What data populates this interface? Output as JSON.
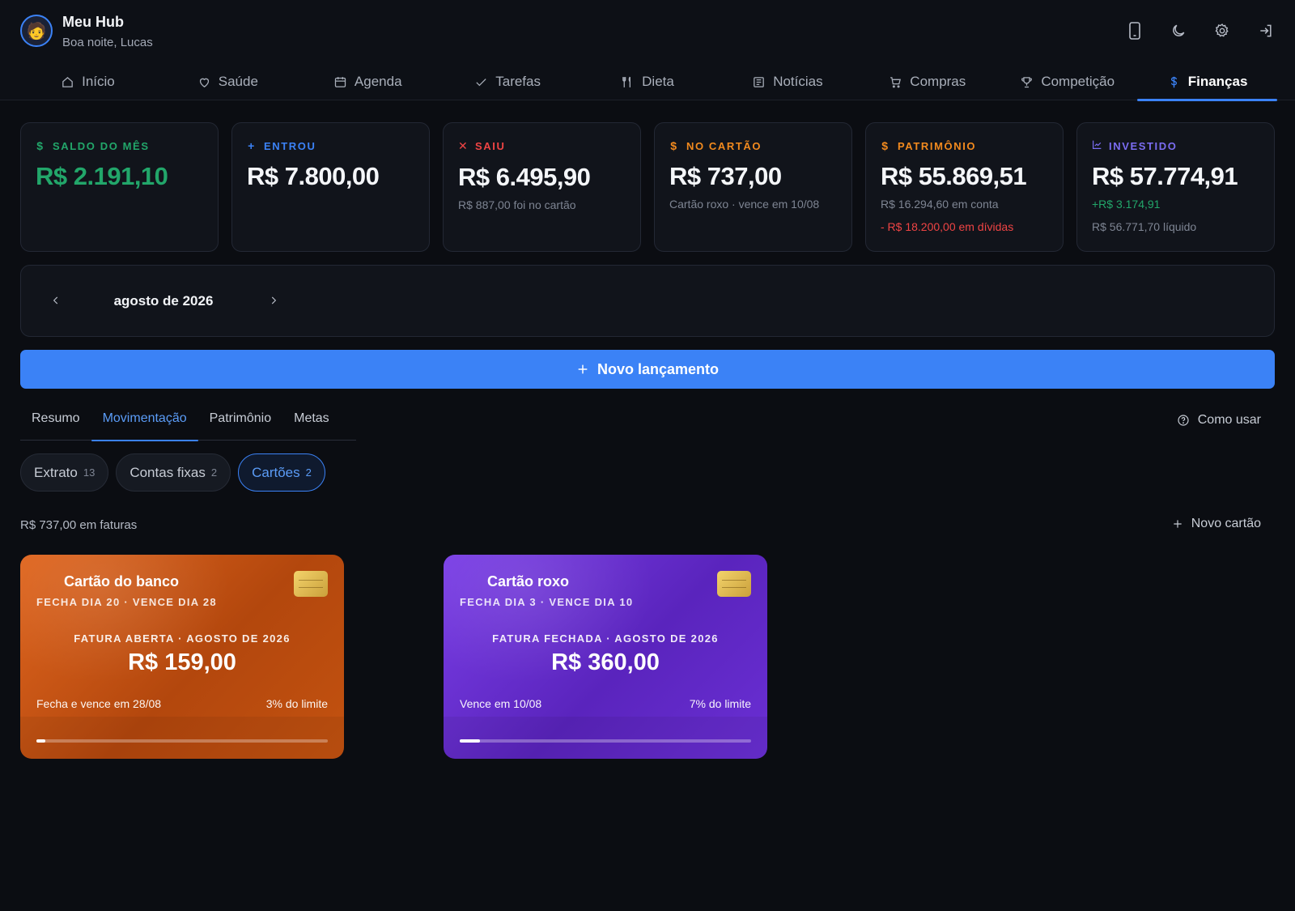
{
  "header": {
    "avatar_emoji": "🧑",
    "title": "Meu Hub",
    "greeting": "Boa noite, Lucas",
    "icons": [
      "phone-icon",
      "moon-icon",
      "gear-icon",
      "logout-icon"
    ]
  },
  "nav": [
    {
      "label": "Início",
      "icon": "home-icon"
    },
    {
      "label": "Saúde",
      "icon": "heart-icon"
    },
    {
      "label": "Agenda",
      "icon": "calendar-icon"
    },
    {
      "label": "Tarefas",
      "icon": "check-icon"
    },
    {
      "label": "Dieta",
      "icon": "utensils-icon"
    },
    {
      "label": "Notícias",
      "icon": "newspaper-icon"
    },
    {
      "label": "Compras",
      "icon": "cart-icon"
    },
    {
      "label": "Competição",
      "icon": "trophy-icon"
    },
    {
      "label": "Finanças",
      "icon": "dollar-icon",
      "active": true
    }
  ],
  "stats": {
    "saldo": {
      "label": "SALDO DO MÊS",
      "value": "R$ 2.191,10"
    },
    "entrou": {
      "label": "ENTROU",
      "value": "R$ 7.800,00"
    },
    "saiu": {
      "label": "SAIU",
      "value": "R$ 6.495,90",
      "sub": "R$ 887,00 foi no cartão"
    },
    "cartao": {
      "label": "NO CARTÃO",
      "value": "R$ 737,00",
      "sub": "Cartão roxo · vence em 10/08"
    },
    "patrimonio": {
      "label": "PATRIMÔNIO",
      "value": "R$ 55.869,51",
      "sub": "R$ 16.294,60 em conta",
      "sub2": "- R$ 18.200,00 em dívidas"
    },
    "investido": {
      "label": "INVESTIDO",
      "value": "R$ 57.774,91",
      "sub": "+R$ 3.174,91",
      "sub2": "R$ 56.771,70 líquido"
    }
  },
  "month": {
    "label": "agosto de 2026"
  },
  "new_entry_label": "Novo lançamento",
  "tabs": [
    {
      "label": "Resumo"
    },
    {
      "label": "Movimentação",
      "active": true
    },
    {
      "label": "Patrimônio"
    },
    {
      "label": "Metas"
    }
  ],
  "help_label": "Como usar",
  "chips": [
    {
      "label": "Extrato",
      "count": "13"
    },
    {
      "label": "Contas fixas",
      "count": "2"
    },
    {
      "label": "Cartões",
      "count": "2",
      "active": true
    }
  ],
  "faturas_total": "R$ 737,00 em faturas",
  "new_card_label": "Novo cartão",
  "cards": [
    {
      "name": "Cartão do banco",
      "dates": "FECHA DIA 20 · VENCE DIA 28",
      "status": "FATURA ABERTA · AGOSTO DE 2026",
      "amount": "R$ 159,00",
      "due": "Fecha e vence em 28/08",
      "limit": "3% do limite",
      "limit_fraction": 0.03,
      "color": "#d45a16"
    },
    {
      "name": "Cartão roxo",
      "dates": "FECHA DIA 3 · VENCE DIA 10",
      "status": "FATURA FECHADA · AGOSTO DE 2026",
      "amount": "R$ 360,00",
      "due": "Vence em 10/08",
      "limit": "7% do limite",
      "limit_fraction": 0.07,
      "color": "#6a2fd4"
    }
  ]
}
